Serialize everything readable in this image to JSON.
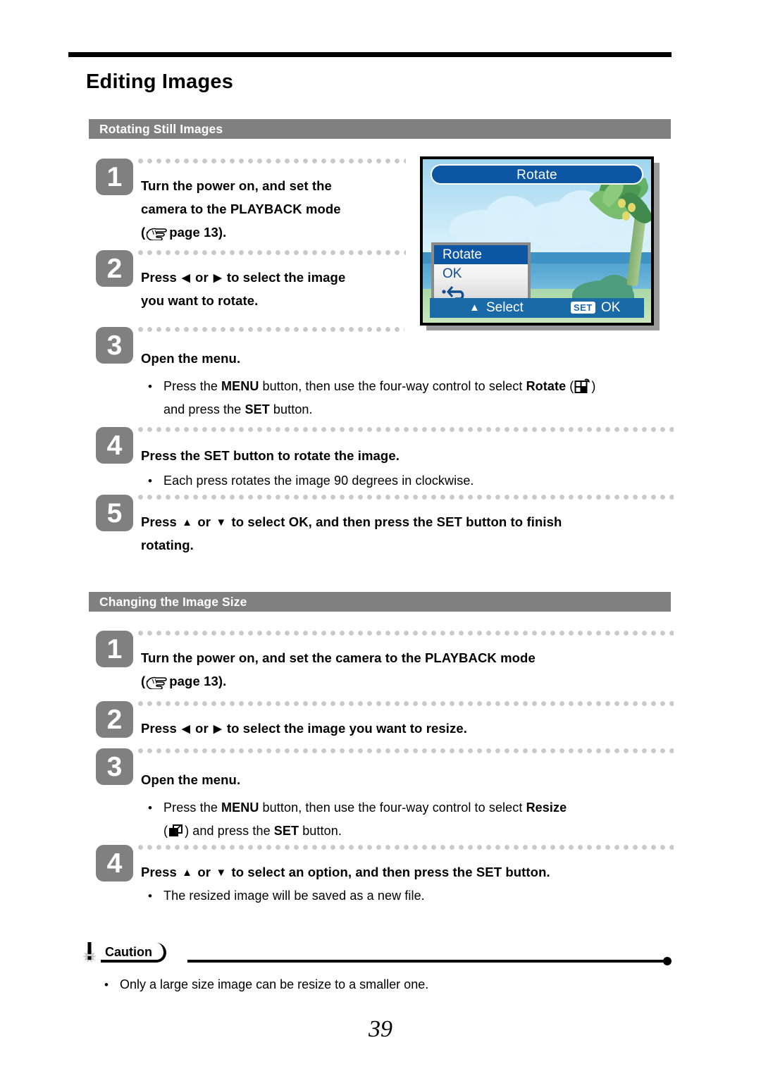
{
  "document": {
    "page_title": "Editing Images",
    "page_number": "39"
  },
  "colors": {
    "section_bar": "#808080",
    "step_badge": "#808080",
    "lcd_blue": "#0d56a4",
    "lcd_bottom_bar": "#1b6aa8",
    "dot_leader": "#c9c9c9"
  },
  "sections": [
    {
      "heading": "Rotating Still Images",
      "steps": [
        {
          "num": "1",
          "text_line1": "Turn the power on, and set the",
          "text_line2": "camera to the PLAYBACK mode",
          "text_line3_prefix": "(",
          "text_line3_suffix": "page 13).",
          "icon": "pointing-hand-icon"
        },
        {
          "num": "2",
          "text_a": "Press",
          "icon_left": "left-triangle-icon",
          "text_or": "or",
          "icon_right": "right-triangle-icon",
          "text_b": "to select the image",
          "text_line2": "you want to rotate."
        },
        {
          "num": "3",
          "text": "Open the menu.",
          "bullet": {
            "seg1": "Press the ",
            "bold1": "MENU",
            "seg2": " button, then use the four-way control to select ",
            "bold2": "Rotate",
            "seg3": " (",
            "icon": "rotate-menu-icon",
            "seg4": ")",
            "line2_seg1": "and press the ",
            "line2_bold": "SET",
            "line2_seg2": " button."
          }
        },
        {
          "num": "4",
          "text": "Press the SET button to rotate the image.",
          "bullet": {
            "text": "Each press rotates the image 90 degrees in clockwise."
          }
        },
        {
          "num": "5",
          "text_a": "Press",
          "icon_up": "up-triangle-icon",
          "text_or": "or",
          "icon_down": "down-triangle-icon",
          "text_b": "to select OK, and then press the SET button to finish",
          "text_line2": "rotating."
        }
      ]
    },
    {
      "heading": "Changing the Image Size",
      "steps": [
        {
          "num": "1",
          "text_line1": "Turn the power on, and set the camera to the PLAYBACK mode",
          "text_line2_prefix": "(",
          "text_line2_suffix": "page 13).",
          "icon": "pointing-hand-icon"
        },
        {
          "num": "2",
          "text_a": "Press",
          "icon_left": "left-triangle-icon",
          "text_or": "or",
          "icon_right": "right-triangle-icon",
          "text_b": "to select the image you want to resize."
        },
        {
          "num": "3",
          "text": "Open the menu.",
          "bullet": {
            "seg1": "Press the ",
            "bold1": "MENU",
            "seg2": " button, then use the four-way control to select ",
            "bold2": "Resize",
            "line2_seg1": "(",
            "icon": "resize-menu-icon",
            "line2_seg2": ") and press the ",
            "line2_bold": "SET",
            "line2_seg3": " button."
          }
        },
        {
          "num": "4",
          "text_a": "Press",
          "icon_up": "up-triangle-icon",
          "text_or": "or",
          "icon_down": "down-triangle-icon",
          "text_b": "to select an option, and then press the SET button.",
          "bullet": {
            "text": "The resized image will be saved as a new file."
          }
        }
      ]
    }
  ],
  "lcd": {
    "title": "Rotate",
    "menu_items": [
      "Rotate",
      "OK"
    ],
    "menu_return_icon": "return-arrow-icon",
    "bottom": {
      "updown_icon": "up-down-arrows-icon",
      "select_label": "Select",
      "set_badge": "SET",
      "ok_label": "OK"
    }
  },
  "caution": {
    "label": "Caution",
    "icon": "exclamation-burst-icon",
    "bullet": "Only a large size image can be resize to a smaller one."
  }
}
